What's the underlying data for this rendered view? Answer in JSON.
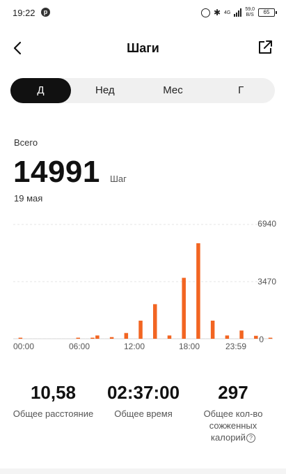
{
  "status_bar": {
    "time": "19:22",
    "notification": "p",
    "network": "4G",
    "speed_value": "59,0",
    "speed_unit": "B/S",
    "battery": "65"
  },
  "header": {
    "title": "Шаги",
    "back_icon": "chevron-left-icon",
    "share_icon": "share-icon"
  },
  "tabs": [
    {
      "label": "Д",
      "active": true
    },
    {
      "label": "Нед",
      "active": false
    },
    {
      "label": "Мес",
      "active": false
    },
    {
      "label": "Г",
      "active": false
    }
  ],
  "summary": {
    "label": "Всего",
    "value": "14991",
    "unit": "Шаг",
    "date": "19 мая"
  },
  "chart_data": {
    "type": "bar",
    "x_tick_labels": [
      "00:00",
      "06:00",
      "12:00",
      "18:00",
      "23:59"
    ],
    "y_tick_labels": [
      "6940",
      "3470",
      "0"
    ],
    "ylim": [
      0,
      6940
    ],
    "grid": true,
    "bar_color": "#f26522",
    "categories": [
      "00:00",
      "00:30",
      "01:00",
      "01:30",
      "02:00",
      "02:30",
      "03:00",
      "03:30",
      "04:00",
      "04:30",
      "05:00",
      "05:30",
      "06:00",
      "06:30",
      "07:00",
      "07:30",
      "08:00",
      "08:30",
      "09:00",
      "09:30",
      "10:00",
      "10:30",
      "11:00",
      "11:30",
      "12:00",
      "12:30",
      "13:00",
      "13:30",
      "14:00",
      "14:30",
      "15:00",
      "15:30",
      "16:00",
      "16:30",
      "17:00",
      "17:30",
      "18:00",
      "18:30",
      "19:00",
      "19:30",
      "20:00",
      "20:30",
      "21:00",
      "21:30",
      "22:00",
      "22:30",
      "23:00",
      "23:30"
    ],
    "values": [
      0,
      30,
      0,
      0,
      0,
      0,
      0,
      0,
      0,
      0,
      0,
      0,
      0,
      10,
      0,
      0,
      60,
      200,
      0,
      0,
      100,
      0,
      0,
      350,
      0,
      0,
      1100,
      0,
      0,
      2100,
      0,
      0,
      200,
      0,
      0,
      3700,
      0,
      0,
      5800,
      0,
      0,
      1100,
      0,
      0,
      200,
      0,
      0,
      500,
      0,
      0,
      180,
      0,
      0,
      60
    ]
  },
  "stats": [
    {
      "value": "10,58",
      "label": "Общее расстояние"
    },
    {
      "value": "02:37:00",
      "label": "Общее время"
    },
    {
      "value": "297",
      "label": "Общее кол-во сожженных калорий"
    }
  ]
}
